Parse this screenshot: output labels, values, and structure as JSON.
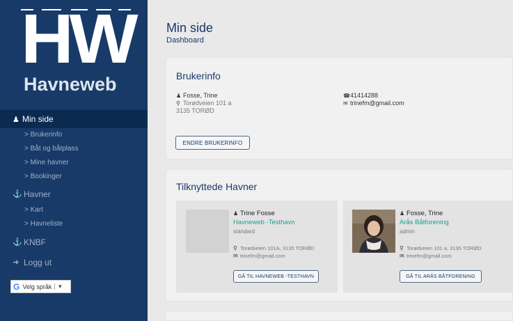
{
  "sidebar": {
    "logo": {
      "mark": "HW",
      "name": "Havneweb"
    },
    "active": {
      "label": "Min side",
      "icon": "user-icon"
    },
    "sub_items": [
      {
        "label": "Brukerinfo"
      },
      {
        "label": "Båt og båtplass"
      },
      {
        "label": "Mine havner"
      },
      {
        "label": "Bookinger"
      }
    ],
    "havner": {
      "label": "Havner",
      "icon": "harbor-icon"
    },
    "havner_items": [
      {
        "label": "Kart"
      },
      {
        "label": "Havneliste"
      }
    ],
    "knbf": {
      "label": "KNBF",
      "icon": "anchor-icon"
    },
    "logout": {
      "label": "Logg ut",
      "icon": "logout-icon"
    },
    "language": {
      "label": "Velg språk",
      "arrow": "▼"
    }
  },
  "header": {
    "title": "Min side",
    "subtitle": "Dashboard"
  },
  "userinfo": {
    "title": "Brukerinfo",
    "name": "Fosse, Trine",
    "address1": "Torødveien 101 a",
    "address2": "3135 TORØD",
    "phone": "41414288",
    "email": "trinefm@gmail.com",
    "edit_button": "ENDRE BRUKERINFO"
  },
  "harbors": {
    "title": "Tilknyttede Havner",
    "cards": [
      {
        "person": "Trine Fosse",
        "harbor": "Havneweb -Testhavn",
        "role": "standard",
        "address": "Torødveien 101A, 3135 TORØD",
        "email": "trinefm@gmail.com",
        "button": "GÅ TIL HAVNEWEB -TESTHAVN"
      },
      {
        "person": "Fosse, Trine",
        "harbor": "Arås Båtforening",
        "role": "admin",
        "address": "Torødveien 101 a, 3135 TORØD",
        "email": "trinefm@gmail.com",
        "button": "GÅ TIL ARÅS BÅTFORENING"
      }
    ]
  },
  "colors": {
    "sidebar": "#183a68",
    "active": "#0b2a50",
    "accent_link": "#1a9e8f",
    "content_bg": "#e9e9e9"
  }
}
